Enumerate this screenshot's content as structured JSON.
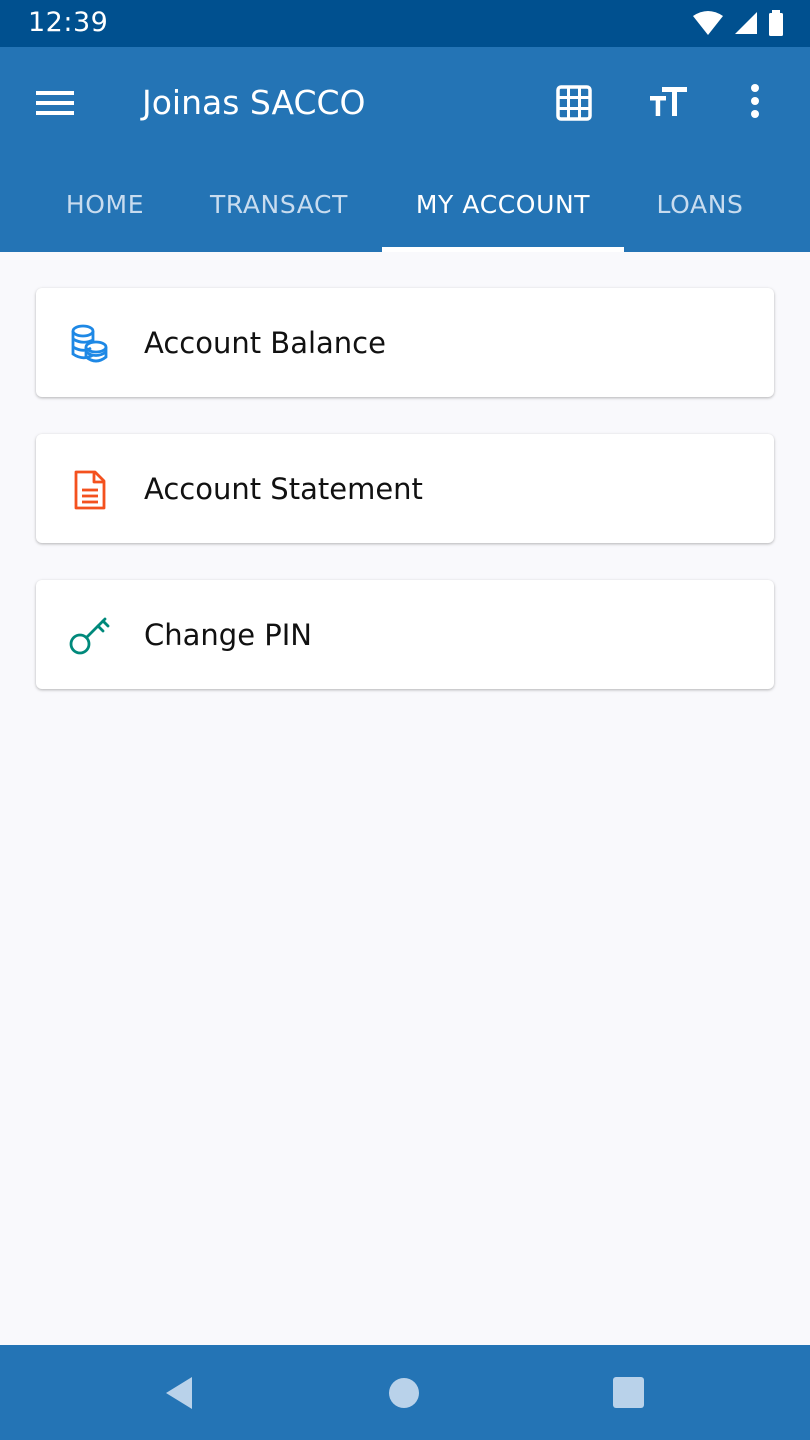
{
  "status_bar": {
    "time": "12:39",
    "icons": [
      "wifi-icon",
      "signal-icon",
      "battery-icon"
    ]
  },
  "app_bar": {
    "title": "Joinas SACCO",
    "icons": [
      "menu-icon",
      "grid-icon",
      "text-size-icon",
      "more-vert-icon"
    ],
    "color": "#2474b5"
  },
  "tabs": [
    {
      "label": "HOME",
      "active": false
    },
    {
      "label": "TRANSACT",
      "active": false
    },
    {
      "label": "MY ACCOUNT",
      "active": true
    },
    {
      "label": "LOANS",
      "active": false
    }
  ],
  "menu_items": [
    {
      "label": "Account Balance",
      "icon": "coins-icon",
      "icon_color": "#1e88e5"
    },
    {
      "label": "Account Statement",
      "icon": "document-icon",
      "icon_color": "#f4511e"
    },
    {
      "label": "Change PIN",
      "icon": "key-icon",
      "icon_color": "#00897b"
    }
  ],
  "nav_bar": {
    "icons": [
      "back-icon",
      "home-icon",
      "recent-apps-icon"
    ]
  }
}
